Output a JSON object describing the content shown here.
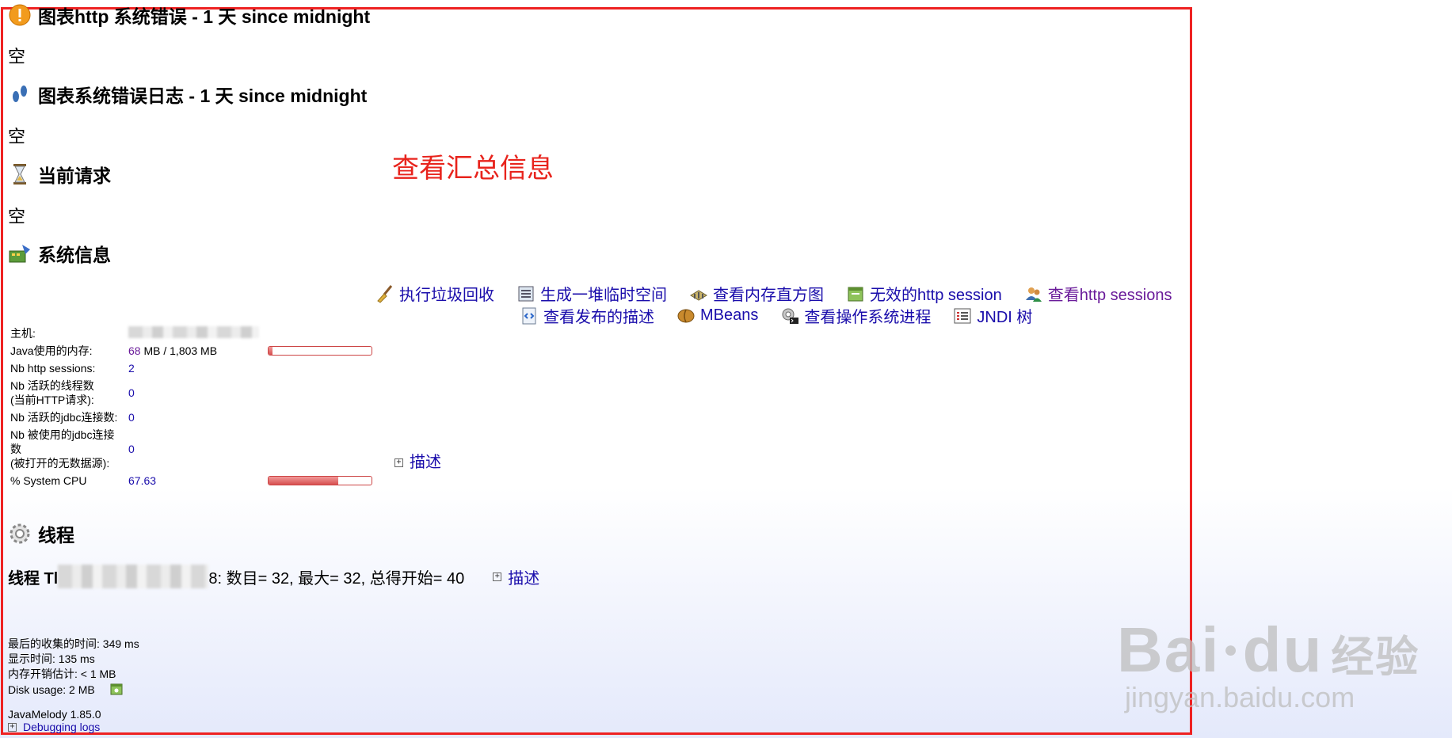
{
  "sections": {
    "http_errors": {
      "title": "图表http 系统错误 - 1 天 since midnight",
      "empty": "空"
    },
    "error_log": {
      "title": "图表系统错误日志 - 1 天 since midnight",
      "empty": "空"
    },
    "current_requests": {
      "title": "当前请求",
      "empty": "空"
    },
    "system_info": {
      "title": "系统信息"
    },
    "threads": {
      "title": "线程"
    }
  },
  "annotation": "查看汇总信息",
  "actions": {
    "row1": [
      {
        "label": "执行垃圾回收",
        "icon": "broom-icon"
      },
      {
        "label": "生成一堆临时空间",
        "icon": "heap-dump-icon"
      },
      {
        "label": "查看内存直方图",
        "icon": "memory-histogram-icon"
      },
      {
        "label": "无效的http session",
        "icon": "invalidate-session-icon"
      },
      {
        "label": "查看http sessions",
        "icon": "sessions-icon"
      }
    ],
    "row2": [
      {
        "label": "查看发布的描述",
        "icon": "deployment-descriptor-icon"
      },
      {
        "label": "MBeans",
        "icon": "mbeans-icon"
      },
      {
        "label": "查看操作系统进程",
        "icon": "processes-icon"
      },
      {
        "label": "JNDI 树",
        "icon": "jndi-tree-icon"
      }
    ]
  },
  "system": {
    "host_label": "主机:",
    "memory_label": "Java使用的内存:",
    "memory_used": "68",
    "memory_rest": " MB / 1,803 MB",
    "memory_fraction": 0.038,
    "sessions_label": "Nb http sessions:",
    "sessions_value": "2",
    "threads_label_1": "Nb 活跃的线程数",
    "threads_label_2": "(当前HTTP请求):",
    "threads_value": "0",
    "jdbc_active_label": "Nb 活跃的jdbc连接数:",
    "jdbc_active_value": "0",
    "jdbc_used_label_1": "Nb 被使用的jdbc连接数",
    "jdbc_used_label_2": "(被打开的无数据源):",
    "jdbc_used_value": "0",
    "cpu_label": "% System CPU",
    "cpu_value": "67.63",
    "cpu_fraction": 0.6763,
    "details_link": "描述"
  },
  "thread_summary": {
    "prefix": "线程 Tl",
    "suffix": "8: 数目= 32, 最大= 32, 总得开始= 40",
    "details_link": "描述"
  },
  "footer": {
    "collect_time": "最后的收集的时间: 349 ms",
    "display_time": "显示时间: 135 ms",
    "memory_overhead": "内存开销估计: < 1 MB",
    "disk_usage": "Disk usage: 2 MB",
    "version": "JavaMelody 1.85.0",
    "debug_logs": "Debugging logs"
  },
  "watermark": {
    "brand": "Bai",
    "brand2": "du",
    "brand_cn": "经验",
    "url": "jingyan.baidu.com"
  }
}
